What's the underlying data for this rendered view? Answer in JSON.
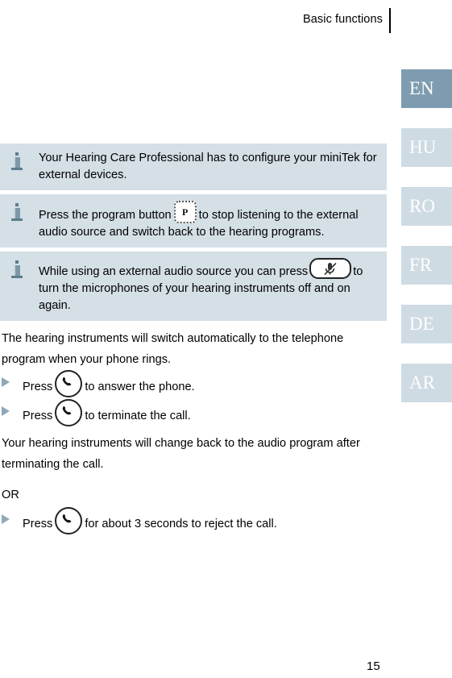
{
  "header": {
    "title": "Basic functions"
  },
  "language_rail": {
    "tabs": [
      {
        "label": "EN",
        "active": true
      },
      {
        "label": "HU",
        "active": false
      },
      {
        "label": "RO",
        "active": false
      },
      {
        "label": "FR",
        "active": false
      },
      {
        "label": "DE",
        "active": false
      },
      {
        "label": "AR",
        "active": false
      }
    ],
    "active_color": "#7e9cb0",
    "inactive_color": "#cedbe3",
    "text_color": "#ffffff"
  },
  "info_boxes": [
    {
      "icon": "info-icon",
      "text_before": "Your Hearing Care Professional has to configure your miniTek for external devices.",
      "inline_icon": null,
      "text_after": ""
    },
    {
      "icon": "info-icon",
      "text_before": "Press the program button",
      "inline_icon": "program-button-icon",
      "inline_icon_label": "P",
      "text_after": "to stop listening to the external audio source and switch back to the hearing programs."
    },
    {
      "icon": "info-icon",
      "text_before": "While using an external audio source you can press",
      "inline_icon": "microphone-mute-icon",
      "text_after": "to turn the microphones of your hearing instruments off and on again."
    }
  ],
  "body": {
    "paragraph_1": "The hearing instruments will switch automatically to the telephone program when your phone rings.",
    "bullet_1": {
      "text_before": "Press",
      "icon": "phone-icon",
      "text_after": "to answer the phone."
    },
    "bullet_2": {
      "text_before": "Press",
      "icon": "phone-icon",
      "text_after": "to terminate the call."
    },
    "paragraph_2": "Your hearing instruments will change back to the audio program after terminating the call.",
    "or_label": "OR",
    "bullet_3": {
      "text_before": "Press",
      "icon": "phone-icon",
      "text_after": "for about 3 seconds to reject the call."
    }
  },
  "footer": {
    "page_number": "15"
  },
  "colors": {
    "info_box_background": "#d4dfe6",
    "bullet_triangle": "#8fa8b8",
    "text": "#000000"
  }
}
